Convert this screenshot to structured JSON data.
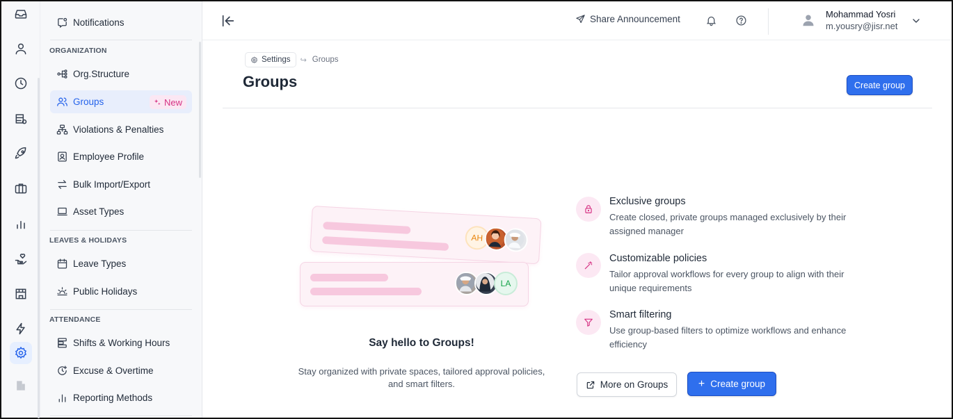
{
  "rail": {
    "items": [
      {
        "icon": "inbox-icon"
      },
      {
        "icon": "user-icon"
      },
      {
        "icon": "clock-icon"
      },
      {
        "icon": "database-icon"
      },
      {
        "icon": "rocket-icon"
      },
      {
        "icon": "briefcase-icon"
      },
      {
        "icon": "bar-chart-icon"
      },
      {
        "icon": "hand-heart-icon"
      },
      {
        "icon": "store-icon"
      },
      {
        "icon": "lightning-icon"
      },
      {
        "icon": "gear-icon",
        "active": true
      },
      {
        "icon": "building-icon"
      }
    ]
  },
  "sidebar": {
    "notifications": "Notifications",
    "organization_heading": "ORGANIZATION",
    "org_structure": "Org.Structure",
    "groups": "Groups",
    "groups_badge": "New",
    "violations": "Violations & Penalties",
    "employee_profile": "Employee Profile",
    "bulk_import": "Bulk Import/Export",
    "asset_types": "Asset Types",
    "leaves_heading": "LEAVES & HOLIDAYS",
    "leave_types": "Leave Types",
    "public_holidays": "Public Holidays",
    "attendance_heading": "ATTENDANCE",
    "shifts": "Shifts & Working Hours",
    "excuse": "Excuse & Overtime",
    "reporting": "Reporting Methods"
  },
  "topbar": {
    "share_label": "Share Announcement",
    "user_name": "Mohammad Yosri",
    "user_email": "m.yousry@jisr.net"
  },
  "breadcrumb": {
    "parent": "Settings",
    "current": "Groups"
  },
  "page": {
    "title": "Groups",
    "create_button": "Create group"
  },
  "illustration": {
    "avatar_initials_1": "AH",
    "avatar_initials_2": "LA"
  },
  "empty_state": {
    "title": "Say hello to Groups!",
    "subtitle": "Stay organized with private spaces, tailored approval policies, and smart filters."
  },
  "features": [
    {
      "title": "Exclusive groups",
      "description": "Create closed, private groups managed exclusively by their assigned manager",
      "icon": "lock-icon"
    },
    {
      "title": "Customizable policies",
      "description": "Tailor approval workflows for every group to align with their unique requirements",
      "icon": "magic-wand-icon"
    },
    {
      "title": "Smart filtering",
      "description": "Use group-based filters to optimize workflows and enhance efficiency",
      "icon": "filter-icon"
    }
  ],
  "actions": {
    "more_label": "More on Groups",
    "create_label": "Create group"
  },
  "colors": {
    "accent": "#2f6fed",
    "badge_pink": "#d63384",
    "active_bg": "#e8eefc"
  }
}
